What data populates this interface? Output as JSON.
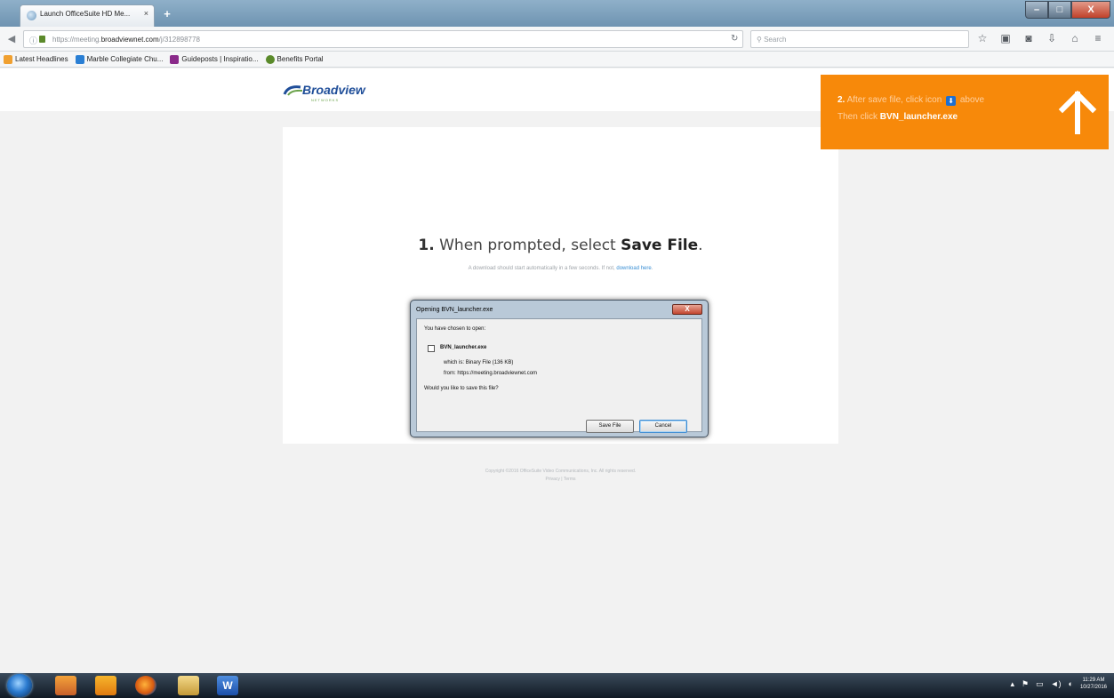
{
  "browser": {
    "tab_title": "Launch OfficeSuite HD Me...",
    "tab_close": "×",
    "new_tab": "+",
    "url_prefix": "https://meeting.",
    "url_host": "broadviewnet.com",
    "url_suffix": "/j/312898778",
    "search_placeholder": "Search",
    "window_buttons": {
      "minimize": "–",
      "maximize": "□",
      "close": "X"
    },
    "toolbar_icons": [
      "star-icon",
      "reading-list-icon",
      "pocket-icon",
      "download-icon",
      "home-icon",
      "menu-icon"
    ]
  },
  "bookmarks": [
    {
      "label": "Latest Headlines",
      "color": "#f0a030"
    },
    {
      "label": "Marble Collegiate Chu...",
      "color": "#2a7fd4"
    },
    {
      "label": "Guideposts | Inspiratio...",
      "color": "#8a2a8a"
    },
    {
      "label": "Benefits Portal",
      "color": "#5a8a2a"
    }
  ],
  "page": {
    "logo_text": "Broadview",
    "logo_sub": "NETWORKS",
    "headline_step": "1.",
    "headline_text": " When prompted, select ",
    "headline_bold": "Save File",
    "headline_end": ".",
    "subline_text": "A download should start automatically in a few seconds. If not, ",
    "subline_link": "download here",
    "copyright_line1": "Copyright ©2016 OfficeSuite Video Communications, Inc. All rights reserved.",
    "copyright_line2": "Privacy | Terms"
  },
  "dialog": {
    "title": "Opening BVN_launcher.exe",
    "close": "X",
    "chosen": "You have chosen to open:",
    "filename": "BVN_launcher.exe",
    "which_is_label": "which is:",
    "which_is_value": "Binary File (136 KB)",
    "from_label": "from:",
    "from_value": "https://meeting.broadviewnet.com",
    "question": "Would you like to save this file?",
    "save_button": "Save File",
    "cancel_button": "Cancel"
  },
  "callout": {
    "step": "2.",
    "line1_text": " After save file, click icon ",
    "line1_end": " above",
    "line2_text": "Then click ",
    "line2_bold": "BVN_launcher.exe",
    "bg_color": "#f7890a"
  },
  "taskbar": {
    "time": "11:29 AM",
    "date": "10/27/2016",
    "apps": [
      "java-app-icon",
      "outlook-icon",
      "firefox-icon",
      "explorer-icon",
      "word-icon"
    ]
  }
}
